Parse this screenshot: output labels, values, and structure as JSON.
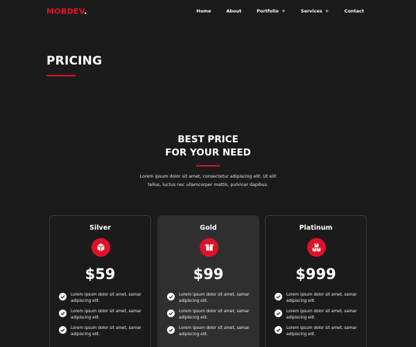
{
  "header": {
    "logo_text": "MOBDEV",
    "logo_dot": ".",
    "nav": [
      {
        "label": "Home",
        "has_submenu": false
      },
      {
        "label": "About",
        "has_submenu": false
      },
      {
        "label": "Portfolio",
        "has_submenu": true
      },
      {
        "label": "Services",
        "has_submenu": true
      },
      {
        "label": "Contact",
        "has_submenu": false
      }
    ],
    "submenu_symbol": "+"
  },
  "page_title": "PRICING",
  "section": {
    "heading_line1": "BEST PRICE",
    "heading_line2": "FOR YOUR NEED",
    "description_line1": "Lorem ipsum dolor sit amet, consectetur adipiscing elit. Ut elit",
    "description_line2": "tellus, luctus nec ullamcorper mattis, pulvinar dapibus."
  },
  "plans": [
    {
      "name": "Silver",
      "icon": "cube-icon",
      "price": "$59",
      "featured": false,
      "features": [
        {
          "line1": "Lorem ipsum dolor sit amet, samar",
          "line2": "adipiscing elit."
        },
        {
          "line1": "Lorem ipsum dolor sit amet, samar",
          "line2": "adipiscing elit."
        },
        {
          "line1": "Lorem ipsum dolor sit amet, samar",
          "line2": "adipiscing elit."
        }
      ]
    },
    {
      "name": "Gold",
      "icon": "open-box-icon",
      "price": "$99",
      "featured": true,
      "features": [
        {
          "line1": "Lorem ipsum dolor sit amet, samar",
          "line2": "adipiscing elit."
        },
        {
          "line1": "Lorem ipsum dolor sit amet, samar",
          "line2": "adipiscing elit."
        },
        {
          "line1": "Lorem ipsum dolor sit amet, samar",
          "line2": "adipiscing elit."
        }
      ]
    },
    {
      "name": "Platinum",
      "icon": "boxes-icon",
      "price": "$999",
      "featured": false,
      "features": [
        {
          "line1": "Lorem ipsum dolor sit amet, samar",
          "line2": "adipiscing elit."
        },
        {
          "line1": "Lorem ipsum dolor sit amet, samar",
          "line2": "adipiscing elit."
        },
        {
          "line1": "Lorem ipsum dolor sit amet, samar",
          "line2": "adipiscing elit."
        }
      ]
    }
  ],
  "colors": {
    "background": "#1b1b1b",
    "accent": "#e0112b",
    "featured_card": "#2f2f2f",
    "text": "#ffffff"
  }
}
